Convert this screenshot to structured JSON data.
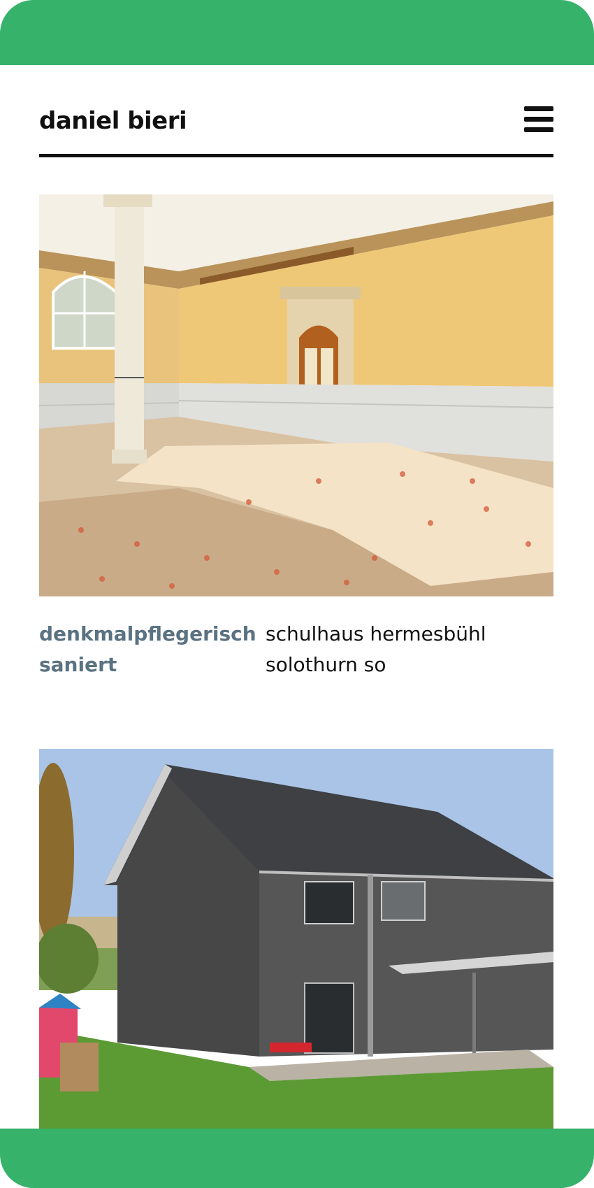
{
  "header": {
    "logo": "daniel bieri",
    "menu_icon": "hamburger-menu-icon"
  },
  "projects": [
    {
      "image_icon": "interior-hall-photo",
      "category_lines": [
        "denkmalpflegerisch",
        "saniert"
      ],
      "title_lines": [
        "schulhaus hermesbühl",
        "solothurn so"
      ]
    },
    {
      "image_icon": "wooden-house-photo"
    }
  ],
  "colors": {
    "frame_green": "#36b26a",
    "category_text": "#5a7281",
    "text": "#111111"
  }
}
